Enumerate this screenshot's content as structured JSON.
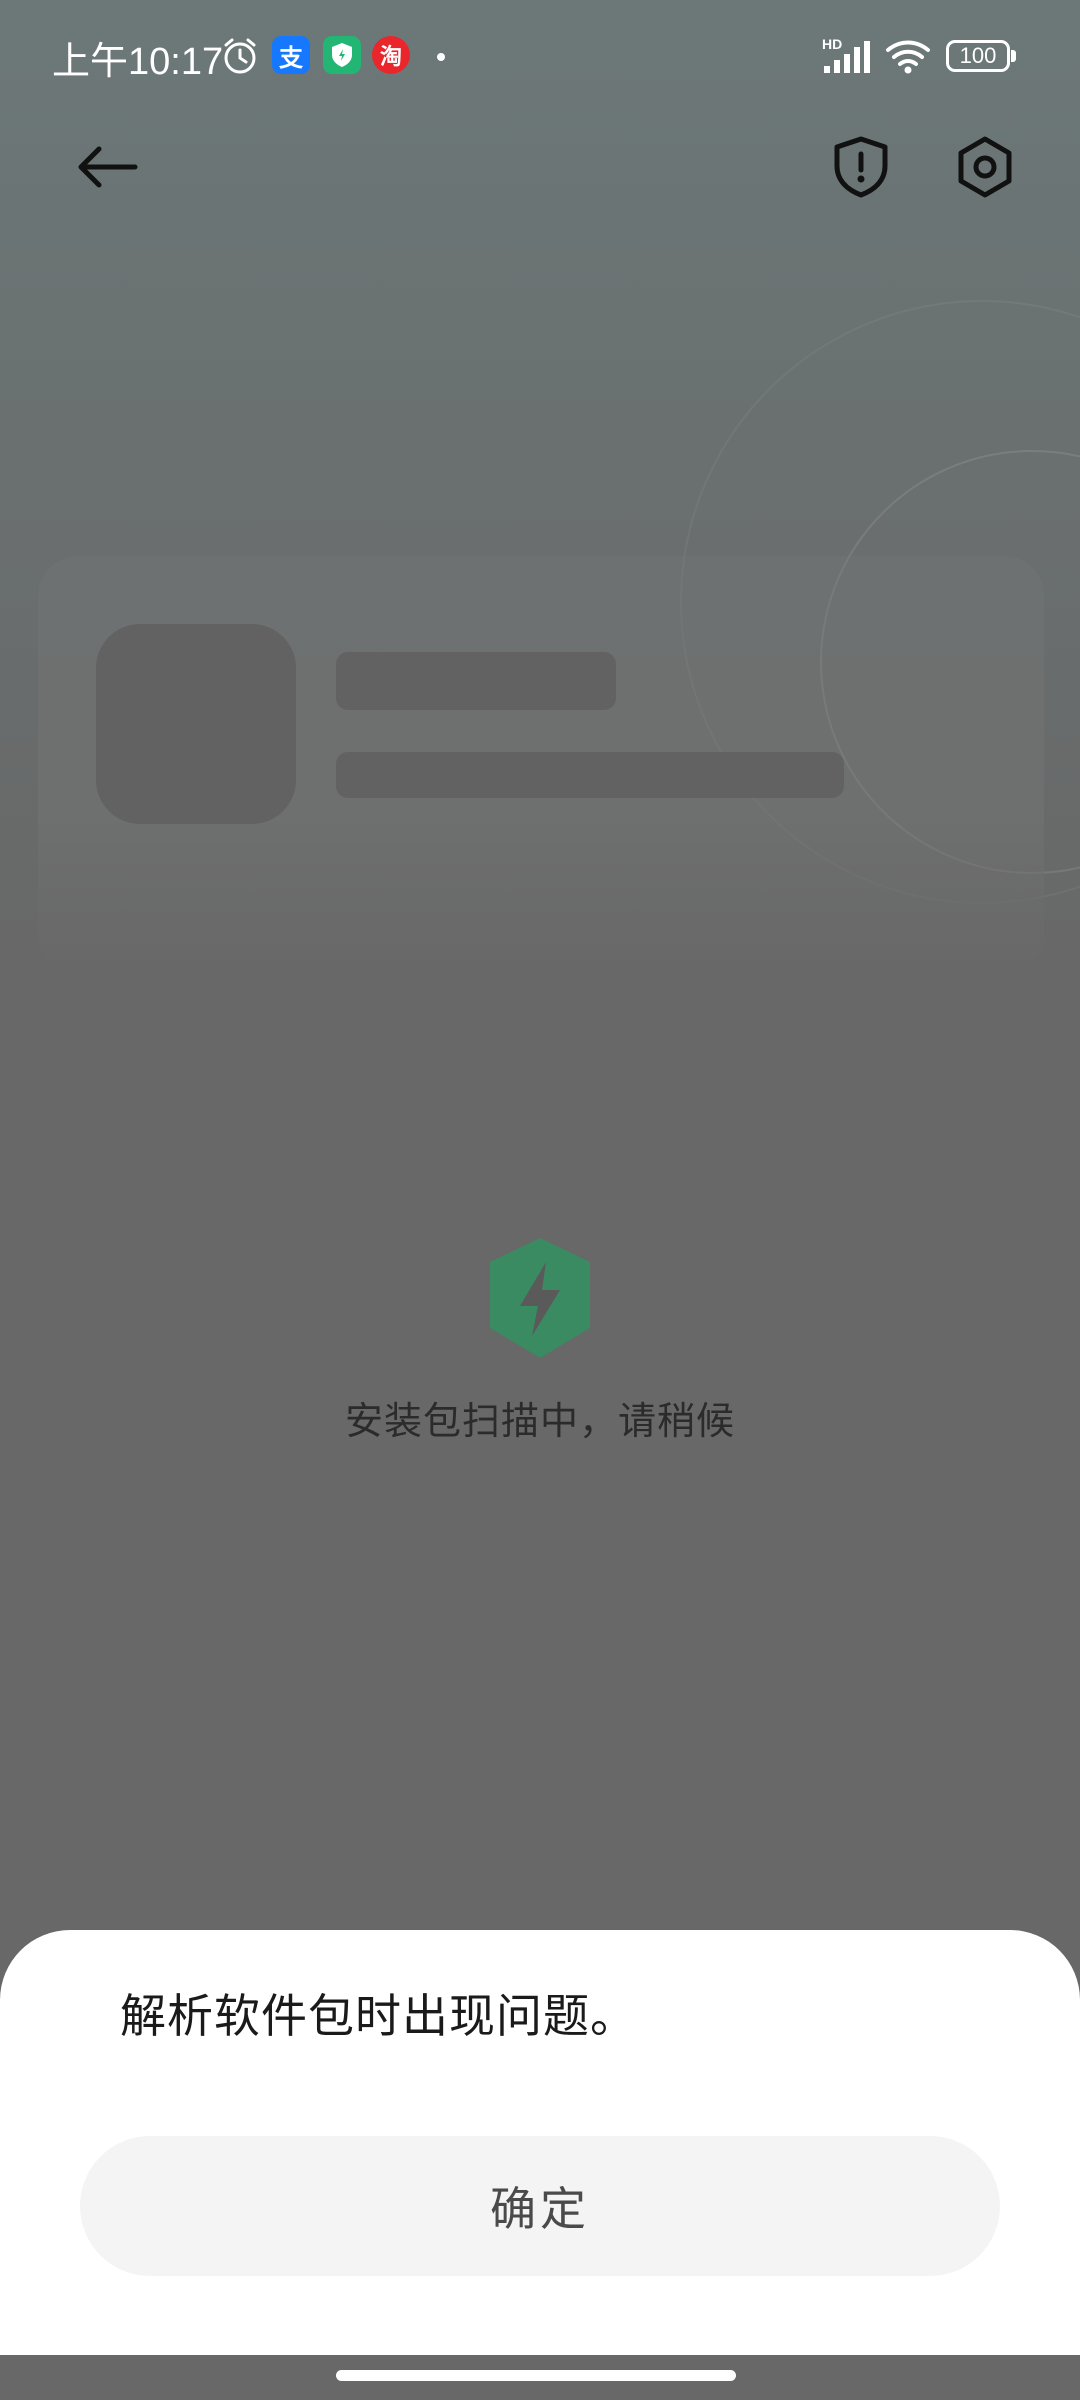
{
  "status_bar": {
    "time": "上午10:17",
    "battery": "100",
    "hd_label": "HD",
    "icons": [
      "alarm-icon",
      "alipay-icon",
      "security-app-icon",
      "taobao-icon",
      "signal-icon",
      "wifi-icon",
      "battery-icon"
    ],
    "alipay_glyph": "支",
    "taobao_glyph": "淘"
  },
  "nav": {
    "back_icon": "back-arrow-icon",
    "shield_icon": "shield-alert-icon",
    "settings_icon": "gear-icon"
  },
  "scan": {
    "icon": "shield-bolt-icon",
    "text": "安装包扫描中，请稍候",
    "accent_color": "#3a8a62"
  },
  "dialog": {
    "message": "解析软件包时出现问题。",
    "confirm_label": "确定"
  }
}
